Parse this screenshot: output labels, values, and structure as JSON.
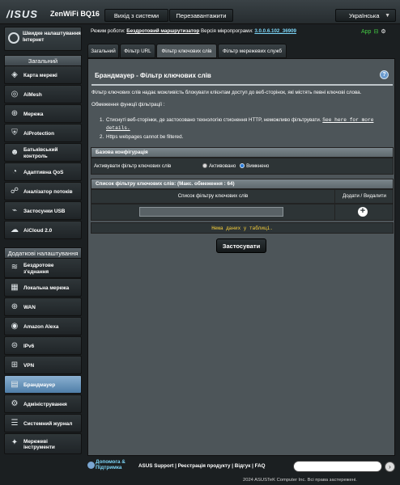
{
  "header": {
    "logo": "/ISUS",
    "model": "ZenWiFi BQ16",
    "logout_label": "Вихід з системи",
    "reboot_label": "Перезавантажити",
    "language": "Українська"
  },
  "status": {
    "mode_label": "Режим роботи:",
    "mode_value": "Бездротовий маршрутизатор",
    "fw_label": "Версія мікропрограми:",
    "fw_value": "3.0.0.6.102_36909",
    "app_label": "App"
  },
  "sidebar": {
    "qis_label": "Швидке налаштування Інтернет",
    "general_title": "Загальний",
    "general_items": [
      {
        "label": "Карта мережі",
        "icon": "map-icon"
      },
      {
        "label": "AiMesh",
        "icon": "aimesh-icon"
      },
      {
        "label": "Мережа",
        "icon": "network-icon"
      },
      {
        "label": "AiProtection",
        "icon": "shield-icon"
      },
      {
        "label": "Батьківський контроль",
        "icon": "parent-icon"
      },
      {
        "label": "Адаптивна QoS",
        "icon": "qos-icon"
      },
      {
        "label": "Аналізатор потоків",
        "icon": "traffic-icon"
      },
      {
        "label": "Застосунки USB",
        "icon": "usb-icon"
      },
      {
        "label": "AiCloud 2.0",
        "icon": "cloud-icon"
      }
    ],
    "advanced_title": "Додаткові налаштування",
    "advanced_items": [
      {
        "label": "Бездротове з'єднання",
        "icon": "wifi-icon"
      },
      {
        "label": "Локальна мережа",
        "icon": "lan-icon"
      },
      {
        "label": "WAN",
        "icon": "wan-icon"
      },
      {
        "label": "Amazon Alexa",
        "icon": "alexa-icon"
      },
      {
        "label": "IPv6",
        "icon": "ipv6-icon"
      },
      {
        "label": "VPN",
        "icon": "vpn-icon"
      },
      {
        "label": "Брандмауер",
        "icon": "firewall-icon"
      },
      {
        "label": "Адміністрування",
        "icon": "admin-icon"
      },
      {
        "label": "Системний журнал",
        "icon": "log-icon"
      },
      {
        "label": "Мережеві інструменти",
        "icon": "tools-icon"
      }
    ]
  },
  "tabs": [
    {
      "label": "Загальний"
    },
    {
      "label": "Фільтр URL"
    },
    {
      "label": "Фільтр ключових слів"
    },
    {
      "label": "Фільтр мережевих служб"
    }
  ],
  "main": {
    "title": "Брандмауер - Фільтр ключових слів",
    "desc": "Фільтр ключових слів надає можливість блокувати клієнтам доступ до веб-сторінок, які містять певні ключові слова.",
    "limits": "Обмеження функції фільтрації :",
    "item1": "Стиснуті веб-сторінки, де застосовано технологію стиснення HTTP, неможливо фільтрувати.",
    "item1_link": "See here for more details.",
    "item2": "Https webpages cannot be filtered.",
    "basic_header": "Базова конфігурація",
    "enable_label": "Активувати фільтр ключових слів",
    "on_label": "Активовано",
    "off_label": "Вимкнено",
    "list_header": "Список фільтру ключових слів: (Макс. обмеження : 64)",
    "col_list": "Список фільтру ключових слів",
    "col_add": "Додати / Видалити",
    "no_data": "Нема даних у таблиці.",
    "apply_label": "Застосувати"
  },
  "footer": {
    "help": "Допомога & Підтримка",
    "links": "ASUS Support | Реєстрація продукту | Відгук | FAQ",
    "copyright": "2024 ASUSTeK Computer Inc. Всі права застережені."
  }
}
